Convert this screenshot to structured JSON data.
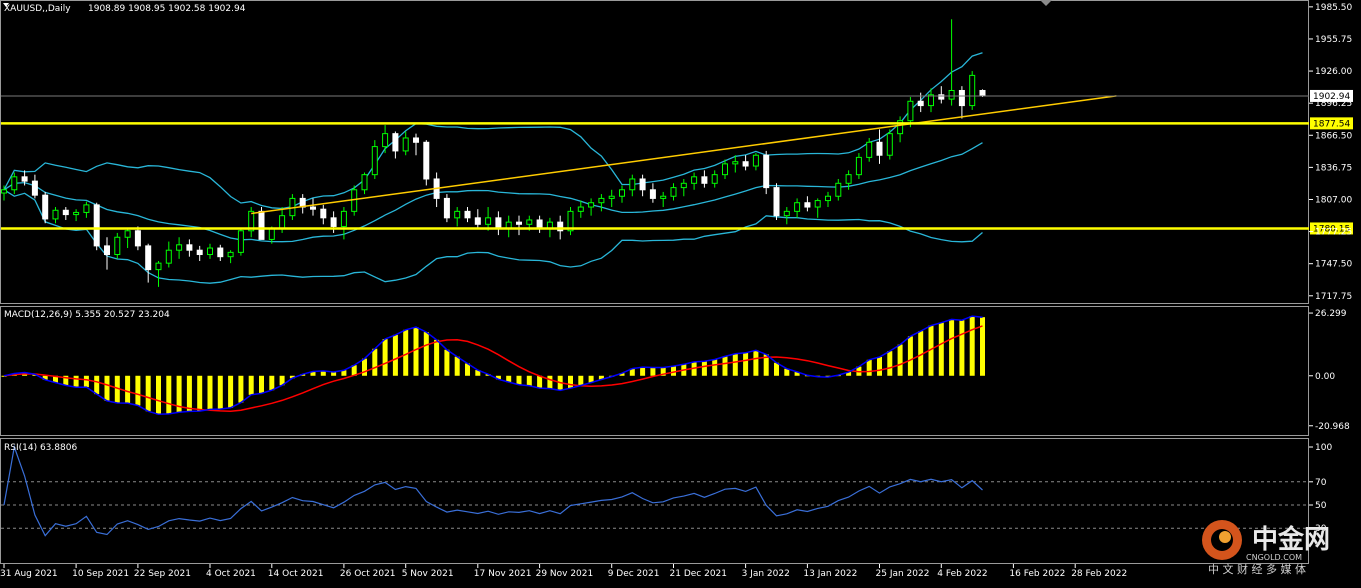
{
  "chart_data": [
    {
      "type": "candlestick",
      "panel": "price",
      "title": "XAUUSD,,Daily",
      "ohlc_text": "1908.89 1908.95 1902.58 1902.94",
      "ylim": [
        1712,
        1990
      ],
      "y_ticks": [
        "1985.50",
        "1955.75",
        "1926.00",
        "1896.25",
        "1866.50",
        "1836.75",
        "1807.00",
        "1777.25",
        "1747.50",
        "1717.75"
      ],
      "current_price": "1902.94",
      "levels": [
        {
          "label": "1877.54",
          "value": 1877.54,
          "color": "#ffff00"
        },
        {
          "label": "1780.15",
          "value": 1780.15,
          "color": "#ffff00"
        }
      ],
      "trendline": {
        "from": [
          24,
          1794
        ],
        "to": [
          108,
          1903
        ],
        "color": "#ffcc00"
      },
      "colors": {
        "bull": "#00ff00",
        "bear": "#ffffff",
        "band": "#29b6d8"
      },
      "x_labels": [
        "31 Aug 2021",
        "10 Sep 2021",
        "22 Sep 2021",
        "4 Oct 2021",
        "14 Oct 2021",
        "26 Oct 2021",
        "5 Nov 2021",
        "17 Nov 2021",
        "29 Nov 2021",
        "9 Dec 2021",
        "21 Dec 2021",
        "3 Jan 2022",
        "13 Jan 2022",
        "25 Jan 2022",
        "4 Feb 2022",
        "16 Feb 2022",
        "28 Feb 2022"
      ],
      "bars": [
        [
          1813,
          1820,
          1806,
          1816
        ],
        [
          1816,
          1832,
          1812,
          1828
        ],
        [
          1828,
          1834,
          1820,
          1824
        ],
        [
          1824,
          1830,
          1808,
          1811
        ],
        [
          1811,
          1814,
          1785,
          1789
        ],
        [
          1789,
          1800,
          1785,
          1797
        ],
        [
          1797,
          1800,
          1788,
          1793
        ],
        [
          1793,
          1798,
          1787,
          1795
        ],
        [
          1795,
          1805,
          1790,
          1802
        ],
        [
          1802,
          1804,
          1760,
          1764
        ],
        [
          1764,
          1772,
          1742,
          1756
        ],
        [
          1756,
          1776,
          1752,
          1772
        ],
        [
          1772,
          1780,
          1762,
          1778
        ],
        [
          1778,
          1782,
          1760,
          1764
        ],
        [
          1764,
          1766,
          1730,
          1742
        ],
        [
          1742,
          1750,
          1726,
          1748
        ],
        [
          1748,
          1768,
          1744,
          1760
        ],
        [
          1760,
          1772,
          1752,
          1765
        ],
        [
          1765,
          1770,
          1754,
          1760
        ],
        [
          1760,
          1764,
          1750,
          1756
        ],
        [
          1756,
          1766,
          1752,
          1762
        ],
        [
          1762,
          1765,
          1750,
          1754
        ],
        [
          1754,
          1760,
          1748,
          1758
        ],
        [
          1758,
          1780,
          1755,
          1778
        ],
        [
          1778,
          1800,
          1772,
          1796
        ],
        [
          1796,
          1800,
          1780,
          1770
        ],
        [
          1770,
          1782,
          1766,
          1780
        ],
        [
          1780,
          1800,
          1776,
          1792
        ],
        [
          1792,
          1812,
          1788,
          1808
        ],
        [
          1808,
          1812,
          1794,
          1800
        ],
        [
          1800,
          1808,
          1792,
          1798
        ],
        [
          1798,
          1802,
          1784,
          1790
        ],
        [
          1790,
          1796,
          1776,
          1782
        ],
        [
          1782,
          1800,
          1770,
          1796
        ],
        [
          1796,
          1820,
          1792,
          1816
        ],
        [
          1816,
          1832,
          1812,
          1830
        ],
        [
          1830,
          1862,
          1826,
          1856
        ],
        [
          1856,
          1876,
          1850,
          1868
        ],
        [
          1868,
          1870,
          1845,
          1852
        ],
        [
          1852,
          1870,
          1848,
          1864
        ],
        [
          1864,
          1868,
          1848,
          1860
        ],
        [
          1860,
          1862,
          1820,
          1826
        ],
        [
          1826,
          1832,
          1800,
          1808
        ],
        [
          1808,
          1812,
          1786,
          1790
        ],
        [
          1790,
          1800,
          1782,
          1796
        ],
        [
          1796,
          1800,
          1786,
          1790
        ],
        [
          1790,
          1798,
          1780,
          1784
        ],
        [
          1784,
          1800,
          1778,
          1790
        ],
        [
          1790,
          1796,
          1774,
          1780
        ],
        [
          1780,
          1792,
          1772,
          1786
        ],
        [
          1786,
          1792,
          1774,
          1784
        ],
        [
          1784,
          1792,
          1778,
          1788
        ],
        [
          1788,
          1792,
          1776,
          1780
        ],
        [
          1780,
          1790,
          1772,
          1786
        ],
        [
          1786,
          1792,
          1770,
          1778
        ],
        [
          1778,
          1800,
          1774,
          1796
        ],
        [
          1796,
          1806,
          1790,
          1800
        ],
        [
          1800,
          1808,
          1792,
          1804
        ],
        [
          1804,
          1812,
          1796,
          1808
        ],
        [
          1808,
          1816,
          1800,
          1810
        ],
        [
          1810,
          1820,
          1804,
          1816
        ],
        [
          1816,
          1830,
          1810,
          1826
        ],
        [
          1826,
          1830,
          1810,
          1816
        ],
        [
          1816,
          1822,
          1804,
          1808
        ],
        [
          1808,
          1814,
          1800,
          1810
        ],
        [
          1810,
          1822,
          1806,
          1818
        ],
        [
          1818,
          1826,
          1810,
          1822
        ],
        [
          1822,
          1832,
          1816,
          1828
        ],
        [
          1828,
          1834,
          1818,
          1822
        ],
        [
          1822,
          1834,
          1818,
          1830
        ],
        [
          1830,
          1844,
          1826,
          1840
        ],
        [
          1840,
          1848,
          1832,
          1842
        ],
        [
          1842,
          1848,
          1834,
          1838
        ],
        [
          1838,
          1850,
          1834,
          1848
        ],
        [
          1848,
          1852,
          1812,
          1818
        ],
        [
          1818,
          1822,
          1788,
          1792
        ],
        [
          1792,
          1800,
          1784,
          1796
        ],
        [
          1796,
          1808,
          1790,
          1804
        ],
        [
          1804,
          1810,
          1796,
          1800
        ],
        [
          1800,
          1808,
          1790,
          1806
        ],
        [
          1806,
          1814,
          1800,
          1810
        ],
        [
          1810,
          1826,
          1806,
          1822
        ],
        [
          1822,
          1834,
          1816,
          1830
        ],
        [
          1830,
          1850,
          1826,
          1846
        ],
        [
          1846,
          1864,
          1842,
          1860
        ],
        [
          1860,
          1872,
          1840,
          1848
        ],
        [
          1848,
          1872,
          1844,
          1868
        ],
        [
          1868,
          1884,
          1860,
          1880
        ],
        [
          1880,
          1902,
          1874,
          1898
        ],
        [
          1898,
          1906,
          1888,
          1894
        ],
        [
          1894,
          1910,
          1888,
          1904
        ],
        [
          1904,
          1912,
          1896,
          1900
        ],
        [
          1900,
          1974,
          1894,
          1908
        ],
        [
          1908,
          1912,
          1882,
          1894
        ],
        [
          1894,
          1926,
          1890,
          1922
        ],
        [
          1908,
          1909,
          1902,
          1903
        ]
      ]
    },
    {
      "type": "bar+line",
      "panel": "macd",
      "title": "MACD(12,26,9) 5.355 20.527 23.204",
      "ylim": [
        -24,
        28
      ],
      "y_ticks": [
        "26.299",
        "0.00",
        "-20.968"
      ],
      "colors": {
        "hist": "#ffff00",
        "macd": "#0000ff",
        "signal": "#ff0000"
      }
    },
    {
      "type": "line",
      "panel": "rsi",
      "title": "RSI(14) 63.8806",
      "ylim": [
        0,
        100
      ],
      "y_ticks": [
        "100",
        "70",
        "50",
        "30",
        "0"
      ],
      "colors": {
        "line": "#3a6fd8"
      }
    }
  ],
  "watermark": {
    "brand": "中金网",
    "site": "CNGOLD.COM",
    "slogan": "中 文 财 经 多 媒 体"
  }
}
